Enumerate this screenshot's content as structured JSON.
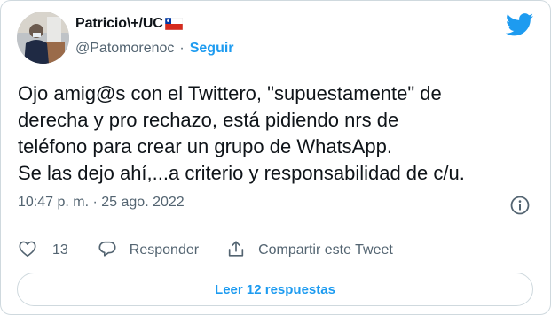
{
  "tweet": {
    "author_name": "Patricio\\+/UC",
    "handle": "@Patomorenoc",
    "separator": "·",
    "follow_label": "Seguir",
    "text": "Ojo amig@s con el Twittero, \"supuestamente\" de\nderecha y pro rechazo, está pidiendo nrs de\nteléfono para crear un grupo de WhatsApp.\nSe las dejo ahí,...a criterio y responsabilidad de c/u.",
    "timestamp": "10:47 p. m. · 25 ago. 2022",
    "likes_count": "13",
    "reply_label": "Responder",
    "share_label": "Compartir este Tweet",
    "read_replies_label": "Leer 12 respuestas"
  },
  "icons": {
    "flag": "chile-flag-icon",
    "logo": "twitter-bird-icon",
    "info": "info-icon",
    "like": "heart-icon",
    "reply": "reply-bubble-icon",
    "share": "share-icon"
  },
  "colors": {
    "accent": "#1d9bf0",
    "secondary_text": "#536471",
    "border": "#cfd9de"
  }
}
